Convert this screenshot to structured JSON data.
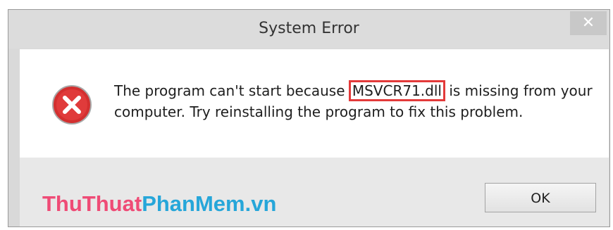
{
  "window": {
    "title": "System Error",
    "close_glyph": "✕"
  },
  "message": {
    "text_before": "The program can't start because ",
    "filename": "MSVCR71.dll",
    "text_after": " is missing from your computer. Try reinstalling the program to fix this problem.",
    "icon": "error-icon"
  },
  "buttons": {
    "ok_label": "OK"
  },
  "watermark": {
    "part1": "ThuThuat",
    "part2": "PhanMem.vn"
  },
  "colors": {
    "highlight_box": "#e33a3a",
    "error_icon": "#d32f2f",
    "watermark_pink": "#ef4b76",
    "watermark_blue": "#26a6d9"
  }
}
